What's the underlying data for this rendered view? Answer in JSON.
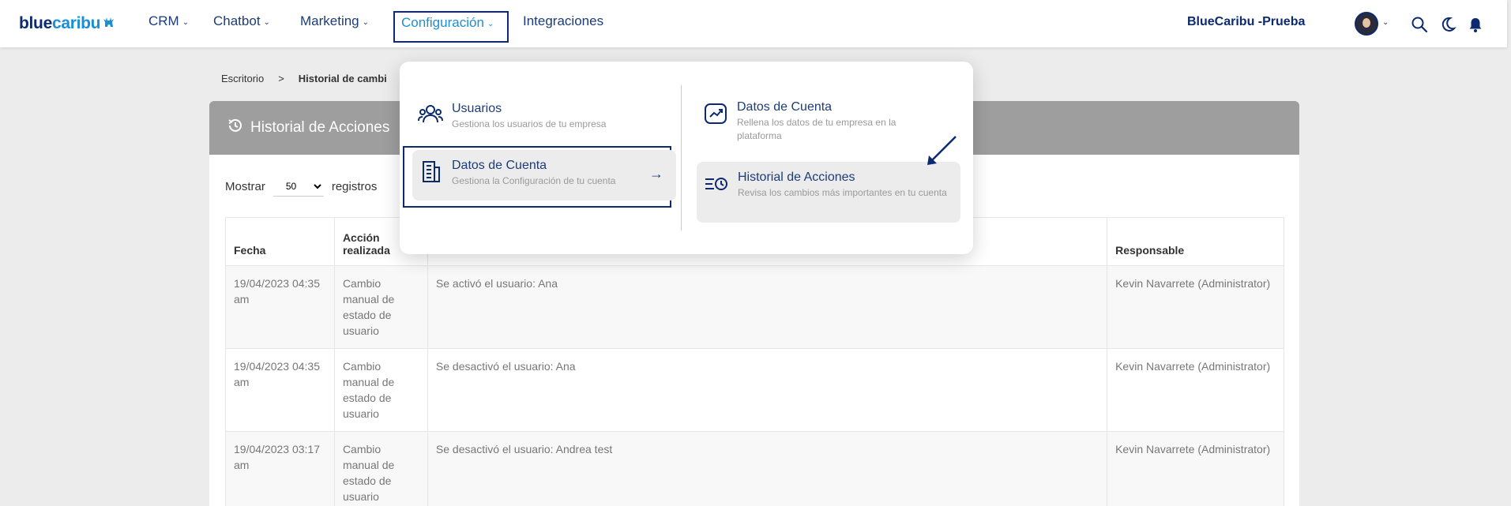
{
  "navbar": {
    "logo_blue": "blue",
    "logo_caribu": "caribu",
    "items": [
      {
        "label": "CRM"
      },
      {
        "label": "Chatbot"
      },
      {
        "label": "Marketing"
      },
      {
        "label": "Configuración"
      },
      {
        "label": "Integraciones"
      }
    ],
    "account_name": "BlueCaribu -Prueba",
    "icons": [
      "search-icon",
      "moon-icon",
      "bell-icon",
      "avatar"
    ]
  },
  "breadcrumb": {
    "home": "Escritorio",
    "separator": ">",
    "current": "Historial de cambi"
  },
  "card": {
    "title": "Historial de Acciones",
    "show_label": "Mostrar",
    "show_value": "50",
    "records_label": "registros",
    "columns": [
      "Fecha",
      "Acción realizada",
      "",
      "Responsable"
    ],
    "rows": [
      {
        "fecha": "19/04/2023 04:35 am",
        "accion": "Cambio manual de estado de usuario",
        "detalle": "Se activó el usuario: Ana",
        "responsable": "Kevin Navarrete (Administrator)"
      },
      {
        "fecha": "19/04/2023 04:35 am",
        "accion": "Cambio manual de estado de usuario",
        "detalle": "Se desactivó el usuario: Ana",
        "responsable": "Kevin Navarrete (Administrator)"
      },
      {
        "fecha": "19/04/2023 03:17 am",
        "accion": "Cambio manual de estado de usuario",
        "detalle": "Se desactivó el usuario: Andrea test",
        "responsable": "Kevin Navarrete (Administrator)"
      }
    ]
  },
  "dropdown": {
    "left": [
      {
        "title": "Usuarios",
        "desc": "Gestiona los usuarios de tu empresa"
      },
      {
        "title": "Datos de Cuenta",
        "desc": "Gestiona la Configuración de tu cuenta"
      }
    ],
    "right": [
      {
        "title": "Datos de Cuenta",
        "desc": "Rellena los datos de tu empresa en la plataforma"
      },
      {
        "title": "Historial de Acciones",
        "desc": "Revisa los cambios más importantes en tu cuenta"
      }
    ]
  },
  "colors": {
    "brand_dark": "#0b2a6f",
    "brand_light": "#1a8fd8",
    "card_header": "#9e9e9e"
  }
}
